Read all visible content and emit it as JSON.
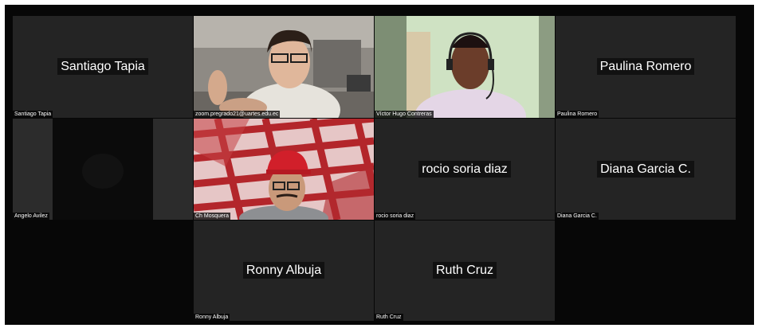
{
  "meeting": {
    "participants": [
      {
        "id": "santiago",
        "display_name": "Santiago Tapia",
        "tag": "Santiago Tapia",
        "video": false
      },
      {
        "id": "zoom21",
        "display_name": "zoom.pregrado21@uartes.edu.ec",
        "tag": "zoom.pregrado21@uartes.edu.ec",
        "video": true
      },
      {
        "id": "victor",
        "display_name": "Víctor Hugo Contreras",
        "tag": "Víctor Hugo Contreras",
        "video": true
      },
      {
        "id": "paulina",
        "display_name": "Paulina Romero",
        "tag": "Paulina Romero",
        "video": false
      },
      {
        "id": "angelo",
        "display_name": "Angelo Avilez",
        "tag": "Angelo Avilez",
        "video": true
      },
      {
        "id": "ch",
        "display_name": "Ch Mosquera",
        "tag": "Ch Mosquera",
        "video": true
      },
      {
        "id": "rocio",
        "display_name": "rocio soria diaz",
        "tag": "rocio soria diaz",
        "video": false
      },
      {
        "id": "diana",
        "display_name": "Diana Garcia C.",
        "tag": "Diana Garcia C.",
        "video": false
      },
      {
        "id": "ronny",
        "display_name": "Ronny Albuja",
        "tag": "Ronny Albuja",
        "video": false
      },
      {
        "id": "ruth",
        "display_name": "Ruth Cruz",
        "tag": "Ruth Cruz",
        "video": false
      }
    ]
  },
  "colors": {
    "background": "#070707",
    "tile": "#242424",
    "name_tag_bg": "#000000",
    "text": "#ffffff"
  }
}
